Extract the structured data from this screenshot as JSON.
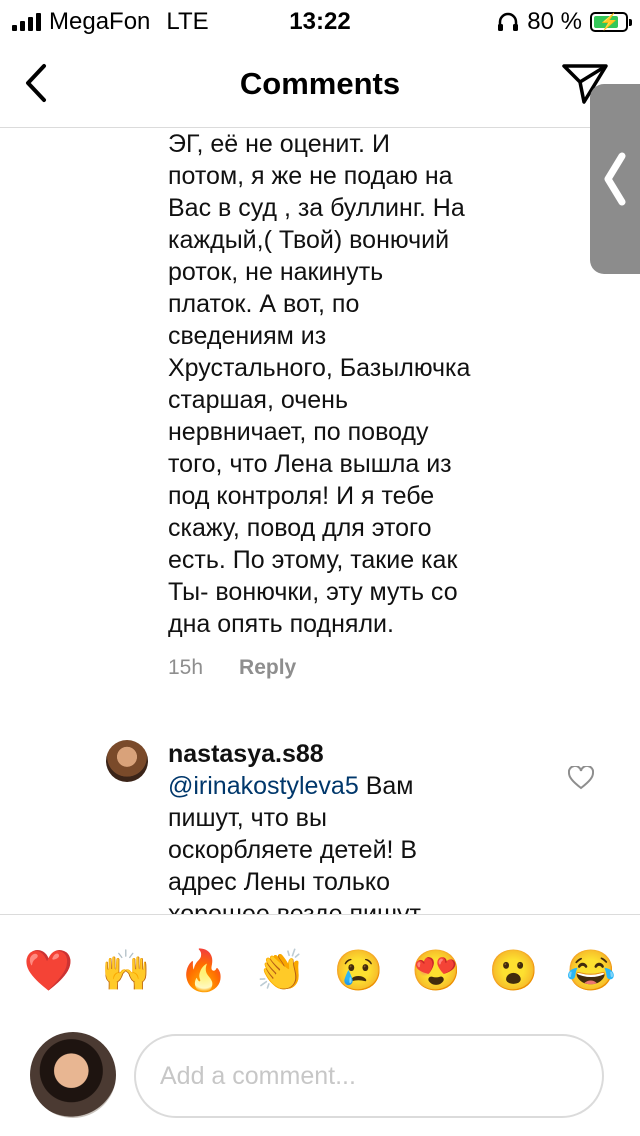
{
  "status_bar": {
    "carrier": "MegaFon",
    "network": "LTE",
    "time": "13:22",
    "battery_percent_label": "80 %",
    "battery_level": 0.8
  },
  "header": {
    "title": "Comments"
  },
  "comments": [
    {
      "username": "",
      "lines": [
        "ЭГ,  её не оценит.  И",
        "потом, я же не подаю на",
        "Вас в суд , за буллинг.  На",
        "каждый,( Твой)  вонючий",
        "роток, не накинуть",
        "платок.  А вот, по",
        "сведениям из",
        "Хрустального, Базылючка",
        "старшая, очень",
        "нервничает, по поводу",
        "того, что Лена вышла из",
        "под контроля!  И я тебе",
        "скажу, повод для этого",
        "есть.  По этому, такие как",
        "Ты- вонючки,  эту муть со",
        "дна опять подняли."
      ],
      "time": "15h",
      "reply_label": "Reply"
    },
    {
      "username": "nastasya.s88",
      "mention": "@irinakostyleva5",
      "first_line_rest": " Вам",
      "lines": [
        "пишут, что вы",
        "оскорбляете детей! В",
        "адрес Лены только",
        "хорошее везде пишут"
      ]
    }
  ],
  "reactions": [
    "❤️",
    "🙌",
    "🔥",
    "👏",
    "😢",
    "😍",
    "😮",
    "😂"
  ],
  "composer": {
    "placeholder": "Add a comment..."
  }
}
